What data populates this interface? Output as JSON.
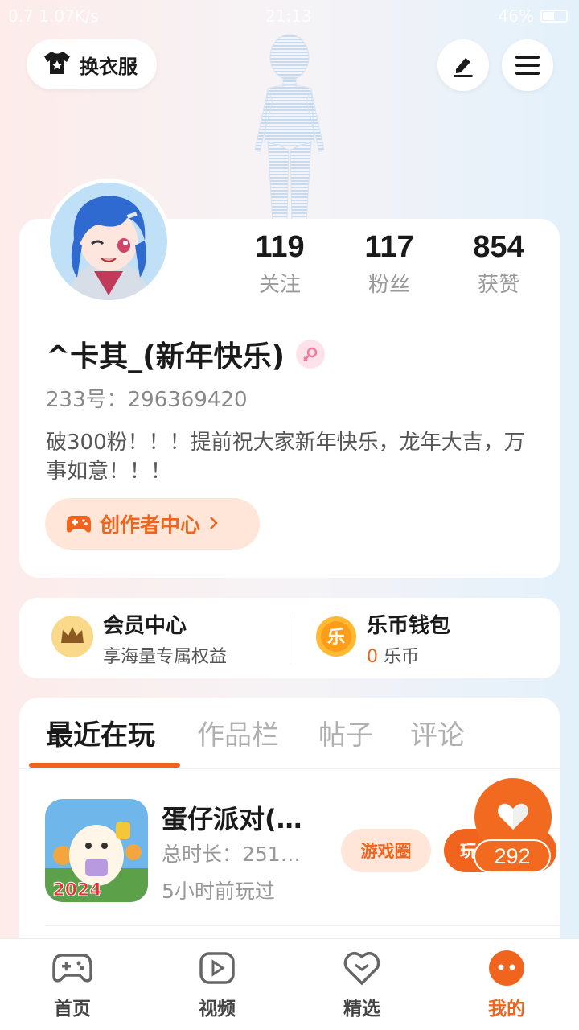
{
  "status_bar": {
    "network": "0.7 1.07K/s",
    "time": "21:13",
    "battery": "46%"
  },
  "header": {
    "outfit_button": "换衣服",
    "edit_icon": "pencil-icon",
    "menu_icon": "hamburger-menu-icon"
  },
  "profile": {
    "stats": [
      {
        "value": "119",
        "label": "关注"
      },
      {
        "value": "117",
        "label": "粉丝"
      },
      {
        "value": "854",
        "label": "获赞"
      }
    ],
    "nickname": "^卡其_(新年快乐)",
    "gender_icon": "female-icon",
    "id_text": "233号：296369420",
    "bio": "破300粉！！！提前祝大家新年快乐，龙年大吉，万事如意！！！",
    "creator_center": "创作者中心"
  },
  "membership": {
    "vip_title": "会员中心",
    "vip_sub": "享海量专属权益",
    "wallet_title": "乐币钱包",
    "wallet_amount": "0",
    "wallet_unit": "乐币",
    "wallet_icon_text": "乐"
  },
  "tabs": [
    {
      "label": "最近在玩",
      "active": true
    },
    {
      "label": "作品栏",
      "active": false
    },
    {
      "label": "帖子",
      "active": false
    },
    {
      "label": "评论",
      "active": false
    }
  ],
  "recent_games": [
    {
      "title": "蛋仔派对(…",
      "playtime": "总时长：251…",
      "last_played": "5小时前玩过",
      "circle_button": "游戏圈",
      "play_button": "玩",
      "icon_badge": "2024"
    }
  ],
  "like_float": {
    "count": "292"
  },
  "bottom_nav": [
    {
      "label": "首页",
      "icon": "gamepad-icon",
      "active": false
    },
    {
      "label": "视频",
      "icon": "video-play-icon",
      "active": false
    },
    {
      "label": "精选",
      "icon": "heart-shield-icon",
      "active": false
    },
    {
      "label": "我的",
      "icon": "profile-face-icon",
      "active": true
    }
  ],
  "colors": {
    "accent": "#f0641e",
    "accent_light": "#ffe6d8"
  }
}
